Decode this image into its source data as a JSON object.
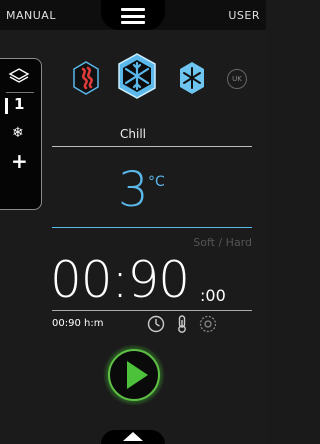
{
  "topbar": {
    "mode_label": "MANUAL",
    "user_label": "USER"
  },
  "rail": {
    "layer_number": "1",
    "snow_glyph": "❄",
    "add_glyph": "+"
  },
  "modes": {
    "uk_badge": "UK"
  },
  "cycle": {
    "name": "Chill"
  },
  "probe": {
    "value": "3",
    "unit": "°C",
    "mode_label": "Soft / Hard"
  },
  "timer": {
    "display": "00:90",
    "seconds_suffix": ":00",
    "summary": "00:90 h:m"
  },
  "colors": {
    "accent_blue": "#5ab8ea",
    "hot_red": "#e23b3b",
    "start_green": "#3a9c2c"
  },
  "icons": [
    "menu-icon",
    "layers-icon",
    "hot-wave-icon",
    "chill-snowflake-icon",
    "freeze-snowflake-icon",
    "clock-icon",
    "probe-icon",
    "cycle-icon",
    "play-icon",
    "chevron-up-icon"
  ]
}
